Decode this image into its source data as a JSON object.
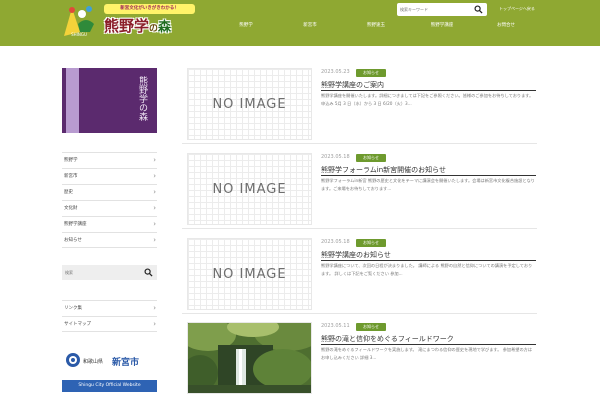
{
  "header": {
    "logo": {
      "tagline": "新宮文化がいきがきわかる！",
      "title_main": "熊野学",
      "title_no": "の",
      "title_tree": "森",
      "mark_caption": "SHINGU"
    },
    "search_placeholder": "検索キーワード",
    "top_link": "トップページへ戻る",
    "nav": [
      "熊野学",
      "新宮市",
      "熊野速玉",
      "熊野学講座",
      "お問合せ"
    ]
  },
  "sidebar": {
    "banner_text": "熊野学の森",
    "menu": [
      {
        "label": "熊野学"
      },
      {
        "label": "新宮市"
      },
      {
        "label": "歴史"
      },
      {
        "label": "文化財"
      },
      {
        "label": "熊野学講座"
      },
      {
        "label": "お知らせ"
      }
    ],
    "search_placeholder": "検索",
    "menu2": [
      {
        "label": "リンク集"
      },
      {
        "label": "サイトマップ"
      }
    ],
    "city": {
      "prefecture": "和歌山県",
      "name": "新宮市",
      "english": "Shingu City Official Website"
    }
  },
  "posts": [
    {
      "date": "2023.05.23",
      "category": "お知らせ",
      "title": "熊野学講座のご案内",
      "excerpt": "熊野学講座を開催いたします。詳細につきましては下記をご参照ください。皆様のご参加をお待ちしております。申込み 5月 3 日（水）から 3 日 6/20（火）3...",
      "image": "NO IMAGE"
    },
    {
      "date": "2023.05.18",
      "category": "お知らせ",
      "title": "熊野学フォーラムin新宮開催のお知らせ",
      "excerpt": "熊野学フォーラムin新宮 熊野の歴史と文化をテーマに講演会を開催いたします。会場は新宮市文化複合施設となります。ご来場をお待ちしております...",
      "image": "NO IMAGE"
    },
    {
      "date": "2023.05.18",
      "category": "お知らせ",
      "title": "熊野学講座のお知らせ",
      "excerpt": "熊野学講座について、次回の日程が決まりました。 講師による 熊野の自然と信仰についての講演を予定しております。 詳しくは下記をご覧ください 参加...",
      "image": "NO IMAGE"
    },
    {
      "date": "2023.05.11",
      "category": "お知らせ",
      "title": "熊野の滝と信仰をめぐるフィールドワーク",
      "excerpt": "熊野の滝をめぐるフィールドワークを実施します。 滝にまつわる信仰の歴史を現地で学びます。 参加希望の方はお申し込みください 詳細 3...",
      "image": "photo"
    }
  ],
  "colors": {
    "header_bg": "#8fa832",
    "category_badge": "#6e9a2e",
    "banner_purple": "#5b2a6e",
    "city_blue": "#2e63b4"
  }
}
